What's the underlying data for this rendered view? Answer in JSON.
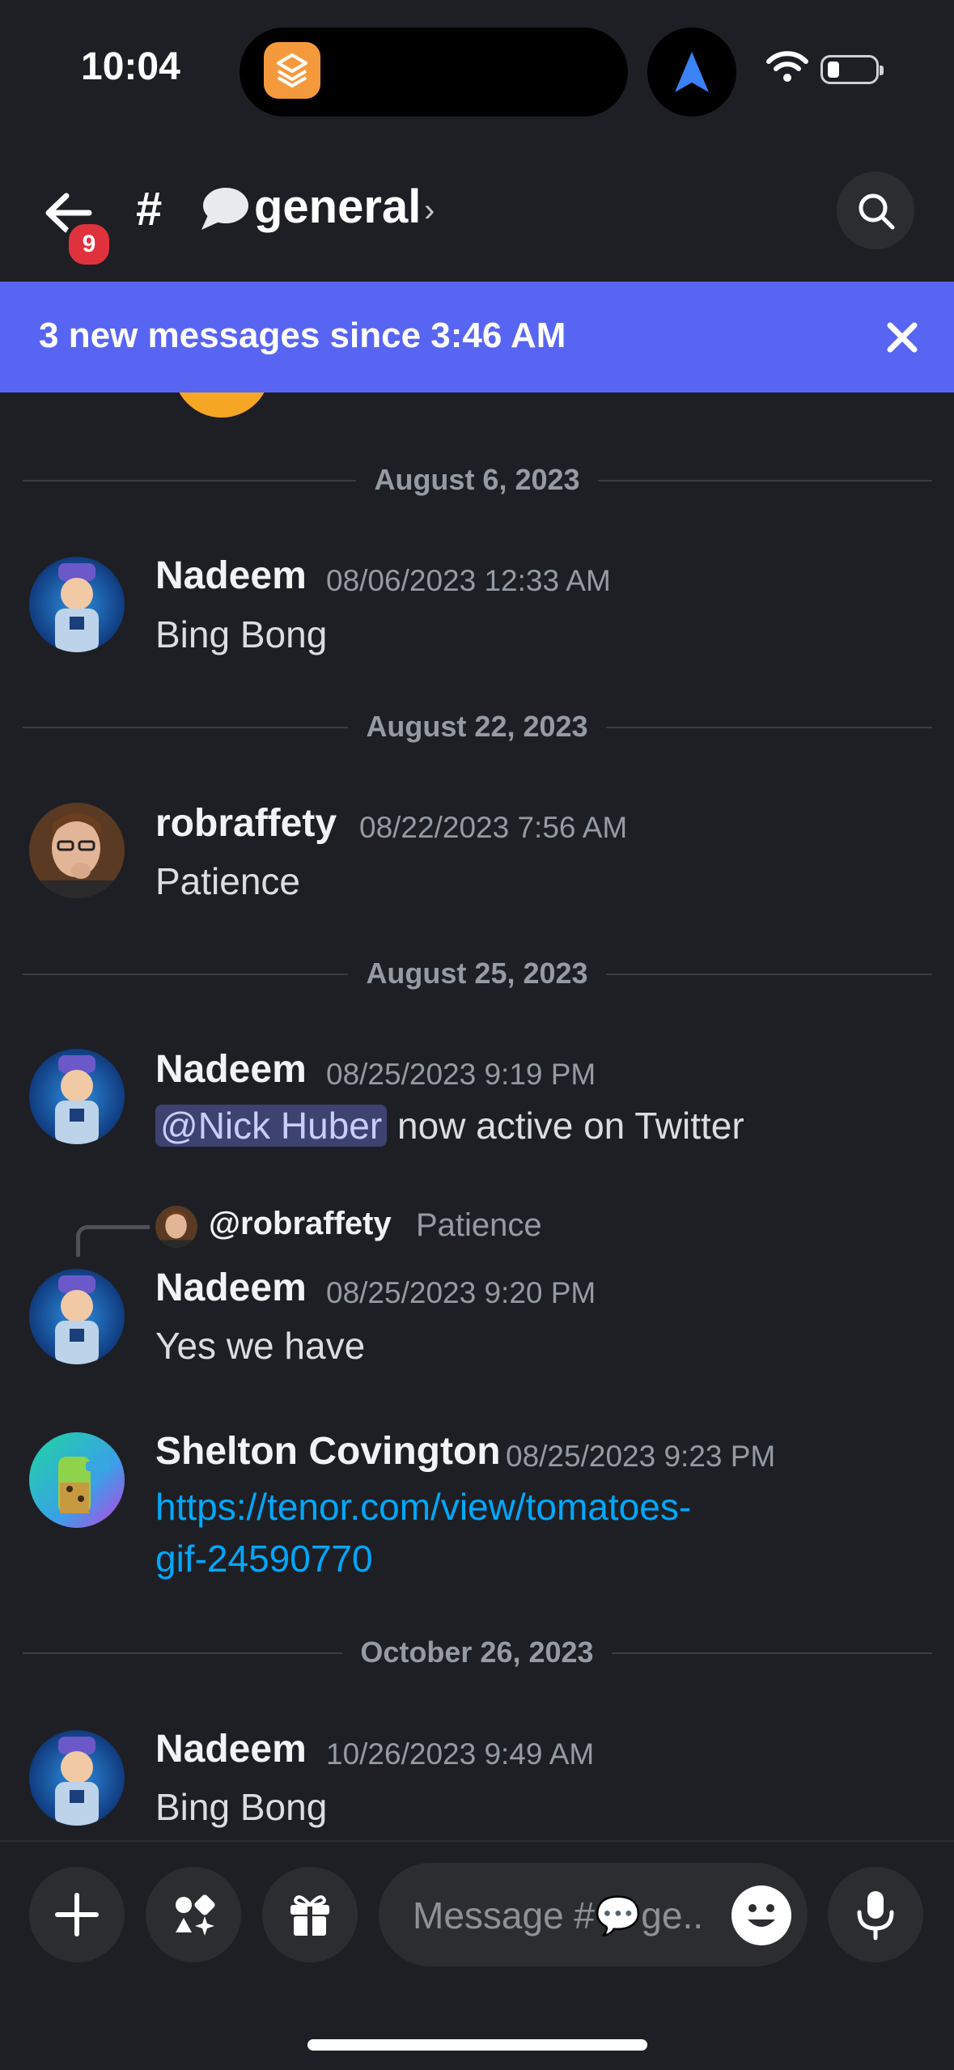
{
  "status_bar": {
    "time": "10:04"
  },
  "header": {
    "back_badge": "9",
    "hash": "#",
    "channel_name": "general",
    "chevron": "›"
  },
  "banner": {
    "text": "3 new messages since 3:46 AM"
  },
  "dates": {
    "d1": "August 6, 2023",
    "d2": "August 22, 2023",
    "d3": "August 25, 2023",
    "d4": "October 26, 2023"
  },
  "messages": [
    {
      "author": "Nadeem",
      "timestamp": "08/06/2023 12:33 AM",
      "text": "Bing Bong"
    },
    {
      "author": "robraffety",
      "timestamp": "08/22/2023 7:56 AM",
      "text": "Patience"
    },
    {
      "author": "Nadeem",
      "timestamp": "08/25/2023 9:19 PM",
      "mention": "@Nick Huber",
      "text": " now active on Twitter"
    },
    {
      "reply_to_author": "@robraffety",
      "reply_to_text": "Patience",
      "author": "Nadeem",
      "timestamp": "08/25/2023 9:20 PM",
      "text": "Yes we have"
    },
    {
      "author": "Shelton Covington",
      "timestamp": "08/25/2023 9:23 PM",
      "link_line1": "https://tenor.com/view/tomatoes-",
      "link_line2": "gif-24590770"
    },
    {
      "author": "Nadeem",
      "timestamp": "10/26/2023 9:49 AM",
      "text": "Bing Bong"
    }
  ],
  "composer": {
    "placeholder": "Message #💬ge.."
  },
  "colors": {
    "accent": "#5865f2",
    "link": "#00a8fc",
    "badge": "#e0323d"
  },
  "icons": [
    "back-arrow-icon",
    "search-icon",
    "close-icon",
    "plus-icon",
    "apps-icon",
    "gift-icon",
    "emoji-icon",
    "microphone-icon",
    "speech-bubble-icon",
    "wifi-icon",
    "battery-icon",
    "navigation-arrow-icon"
  ]
}
